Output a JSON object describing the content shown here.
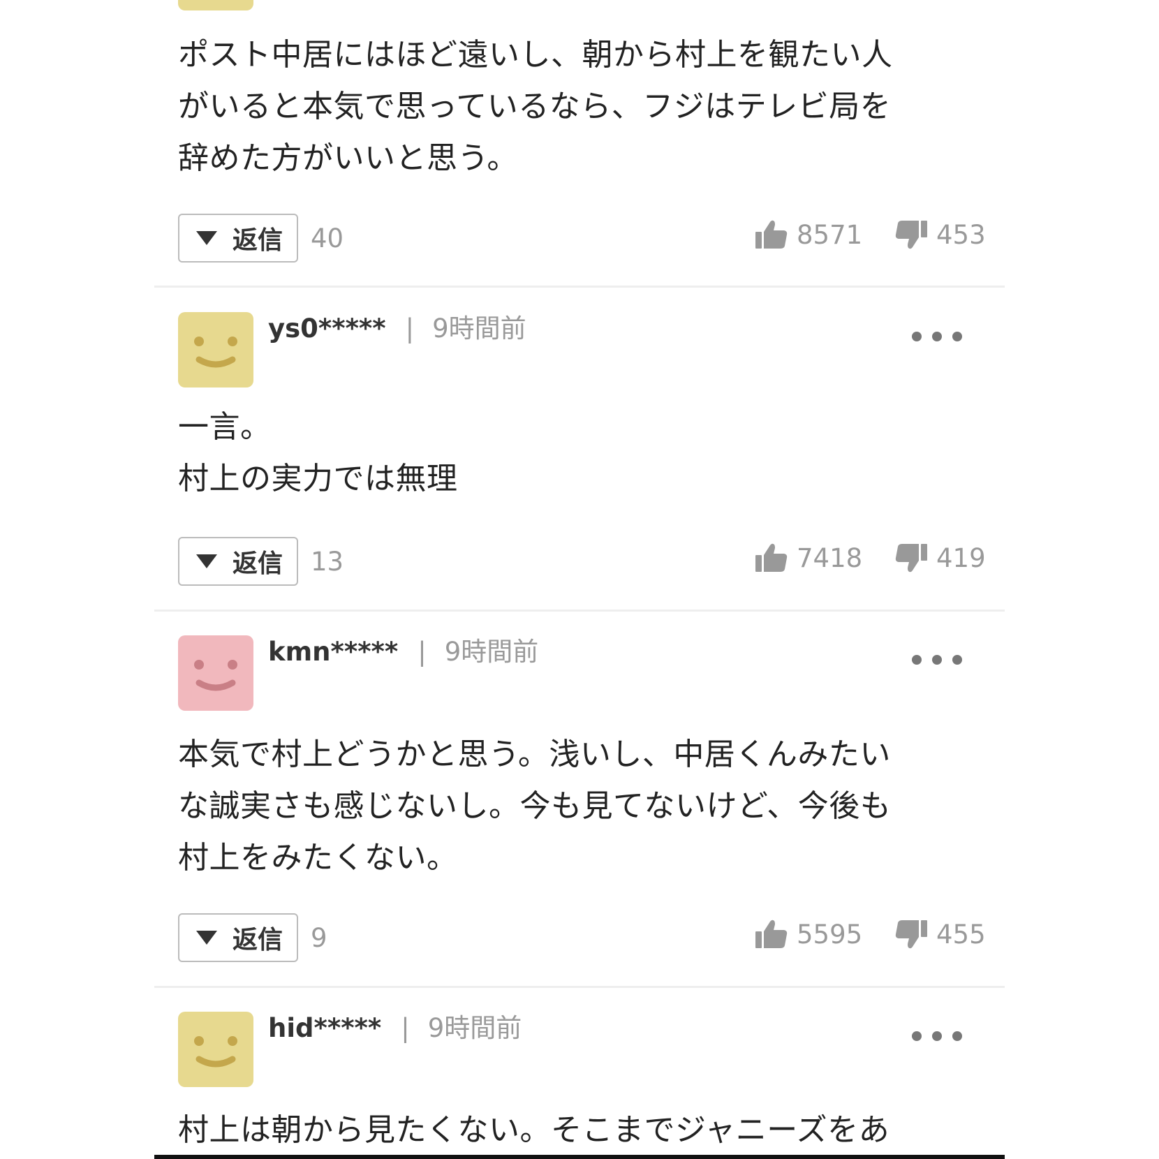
{
  "reply_label": "返信",
  "separator": "|",
  "colors": {
    "avatar_yellow": "#e7d98f",
    "avatar_yellow_face": "#c4a74c",
    "avatar_pink": "#f1b8bd",
    "avatar_pink_face": "#c97f86"
  },
  "comments": [
    {
      "body": "ポスト中居にはほど遠いし、朝から村上を観たい人\nがいると本気で思っているなら、フジはテレビ局を\n辞めた方がいいと思う。",
      "reply_count": "40",
      "likes": "8571",
      "dislikes": "453"
    },
    {
      "username": "ys0*****",
      "time": "9時間前",
      "avatar": "smile-yellow",
      "body": "一言。\n村上の実力では無理",
      "reply_count": "13",
      "likes": "7418",
      "dislikes": "419"
    },
    {
      "username": "kmn*****",
      "time": "9時間前",
      "avatar": "smile-pink",
      "body": "本気で村上どうかと思う。浅いし、中居くんみたい\nな誠実さも感じないし。今も見てないけど、今後も\n村上をみたくない。",
      "reply_count": "9",
      "likes": "5595",
      "dislikes": "455"
    },
    {
      "username": "hid*****",
      "time": "9時間前",
      "avatar": "smile-yellow",
      "body": "村上は朝から見たくない。そこまでジャニーズをあ"
    }
  ]
}
